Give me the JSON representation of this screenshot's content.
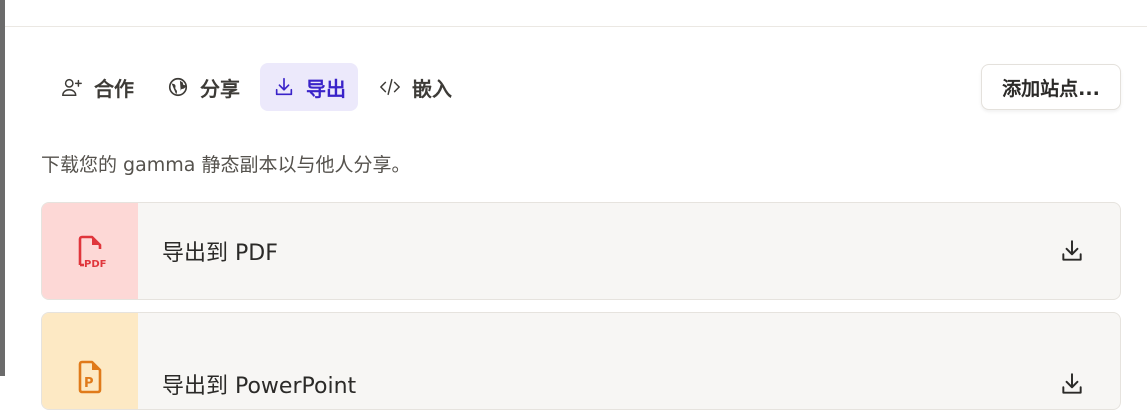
{
  "tabs": [
    {
      "label": "合作",
      "icon": "add-user-icon",
      "active": false
    },
    {
      "label": "分享",
      "icon": "globe-icon",
      "active": false
    },
    {
      "label": "导出",
      "icon": "download-icon",
      "active": true
    },
    {
      "label": "嵌入",
      "icon": "code-icon",
      "active": false
    }
  ],
  "add_site_label": "添加站点...",
  "description": "下载您的 gamma 静态副本以与他人分享。",
  "exports": [
    {
      "label": "导出到 PDF",
      "icon": "pdf-file-icon",
      "icon_text": "PDF",
      "color": "#e0363c",
      "bg": "#fdd8d6"
    },
    {
      "label": "导出到 PowerPoint",
      "icon": "powerpoint-file-icon",
      "icon_text": "P",
      "color": "#e07a1a",
      "bg": "#fde9c4"
    }
  ],
  "colors": {
    "accent": "#3a23c9",
    "active_tab_bg": "#ece9fb"
  }
}
